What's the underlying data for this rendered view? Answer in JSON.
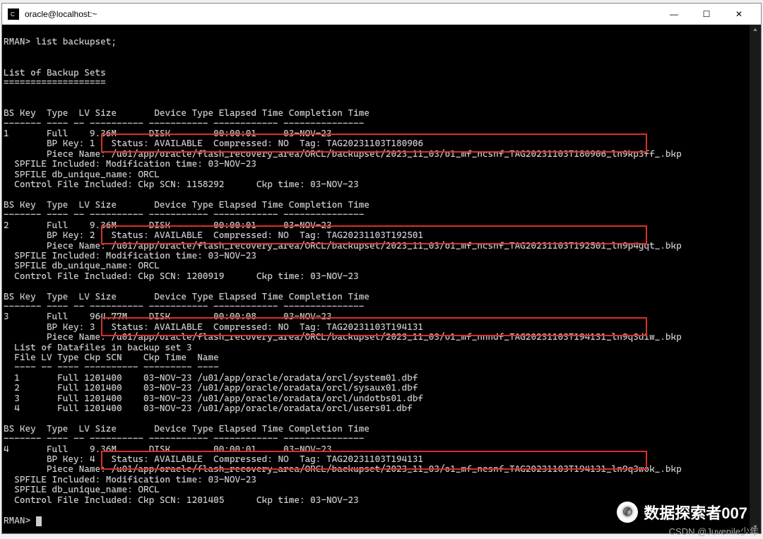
{
  "window": {
    "title": "oracle@localhost:~",
    "controls": {
      "min": "—",
      "max": "☐",
      "close": "✕"
    }
  },
  "prompt": "RMAN>",
  "command": "list backupset;",
  "heading": "List of Backup Sets",
  "heading_underline": "===================",
  "col_header": "BS Key  Type  LV Size       Device Type Elapsed Time Completion Time",
  "col_dash": "------- ---- -- ---------- ----------- ------------ ---------------",
  "bs1": {
    "row": "1       Full    9.36M      DISK        00:00:01     03-NOV-23",
    "bpkey": "        BP Key: 1   Status: AVAILABLE  Compressed: NO  Tag: TAG20231103T180906",
    "piece_l": "        Piece Name: ",
    "piece_p": "/u01/app/oracle/flash_recovery_area/ORCL/backupset/2023_11_03/o1_mf_ncsnf_TAG20231103T180906_ln9kp3ff_.bkp",
    "sp1": "  SPFILE Included: Modification time: 03-NOV-23",
    "sp2": "  SPFILE db_unique_name: ORCL",
    "ctrl": "  Control File Included: Ckp SCN: 1158292      Ckp time: 03-NOV-23"
  },
  "bs2": {
    "row": "2       Full    9.36M      DISK        00:00:01     03-NOV-23",
    "bpkey": "        BP Key: 2   Status: AVAILABLE  Compressed: NO  Tag: TAG20231103T192501",
    "piece_l": "        Piece Name: ",
    "piece_p": "/u01/app/oracle/flash_recovery_area/ORCL/backupset/2023_11_03/o1_mf_ncsnf_TAG20231103T192501_ln9p4gqt_.bkp",
    "sp1": "  SPFILE Included: Modification time: 03-NOV-23",
    "sp2": "  SPFILE db_unique_name: ORCL",
    "ctrl": "  Control File Included: Ckp SCN: 1200919      Ckp time: 03-NOV-23"
  },
  "bs3": {
    "row": "3       Full    964.77M    DISK        00:00:08     03-NOV-23",
    "bpkey": "        BP Key: 3   Status: AVAILABLE  Compressed: NO  Tag: TAG20231103T194131",
    "piece_l": "        Piece Name: ",
    "piece_p": "/u01/app/oracle/flash_recovery_area/ORCL/backupset/2023_11_03/o1_mf_nnndf_TAG20231103T194131_ln9q3d1w_.bkp",
    "df_head": "  List of Datafiles in backup set 3",
    "df_cols": "  File LV Type Ckp SCN    Ckp Time  Name",
    "df_dash": "  ---- -- ---- ---------- --------- ----",
    "df1": "  1       Full 1201400    03-NOV-23 /u01/app/oracle/oradata/orcl/system01.dbf",
    "df2": "  2       Full 1201400    03-NOV-23 /u01/app/oracle/oradata/orcl/sysaux01.dbf",
    "df3": "  3       Full 1201400    03-NOV-23 /u01/app/oracle/oradata/orcl/undotbs01.dbf",
    "df4": "  4       Full 1201400    03-NOV-23 /u01/app/oracle/oradata/orcl/users01.dbf"
  },
  "bs4": {
    "row": "4       Full    9.36M      DISK        00:00:01     03-NOV-23",
    "bpkey": "        BP Key: 4   Status: AVAILABLE  Compressed: NO  Tag: TAG20231103T194131",
    "piece_l": "        Piece Name: ",
    "piece_p": "/u01/app/oracle/flash_recovery_area/ORCL/backupset/2023_11_03/o1_mf_ncsnf_TAG20231103T194131_ln9q3wok_.bkp",
    "sp1": "  SPFILE Included: Modification time: 03-NOV-23",
    "sp2": "  SPFILE db_unique_name: ORCL",
    "ctrl": "  Control File Included: Ckp SCN: 1201405      Ckp time: 03-NOV-23"
  },
  "watermark": "数据探索者007",
  "csdn": "CSDN @Juvenile少年"
}
